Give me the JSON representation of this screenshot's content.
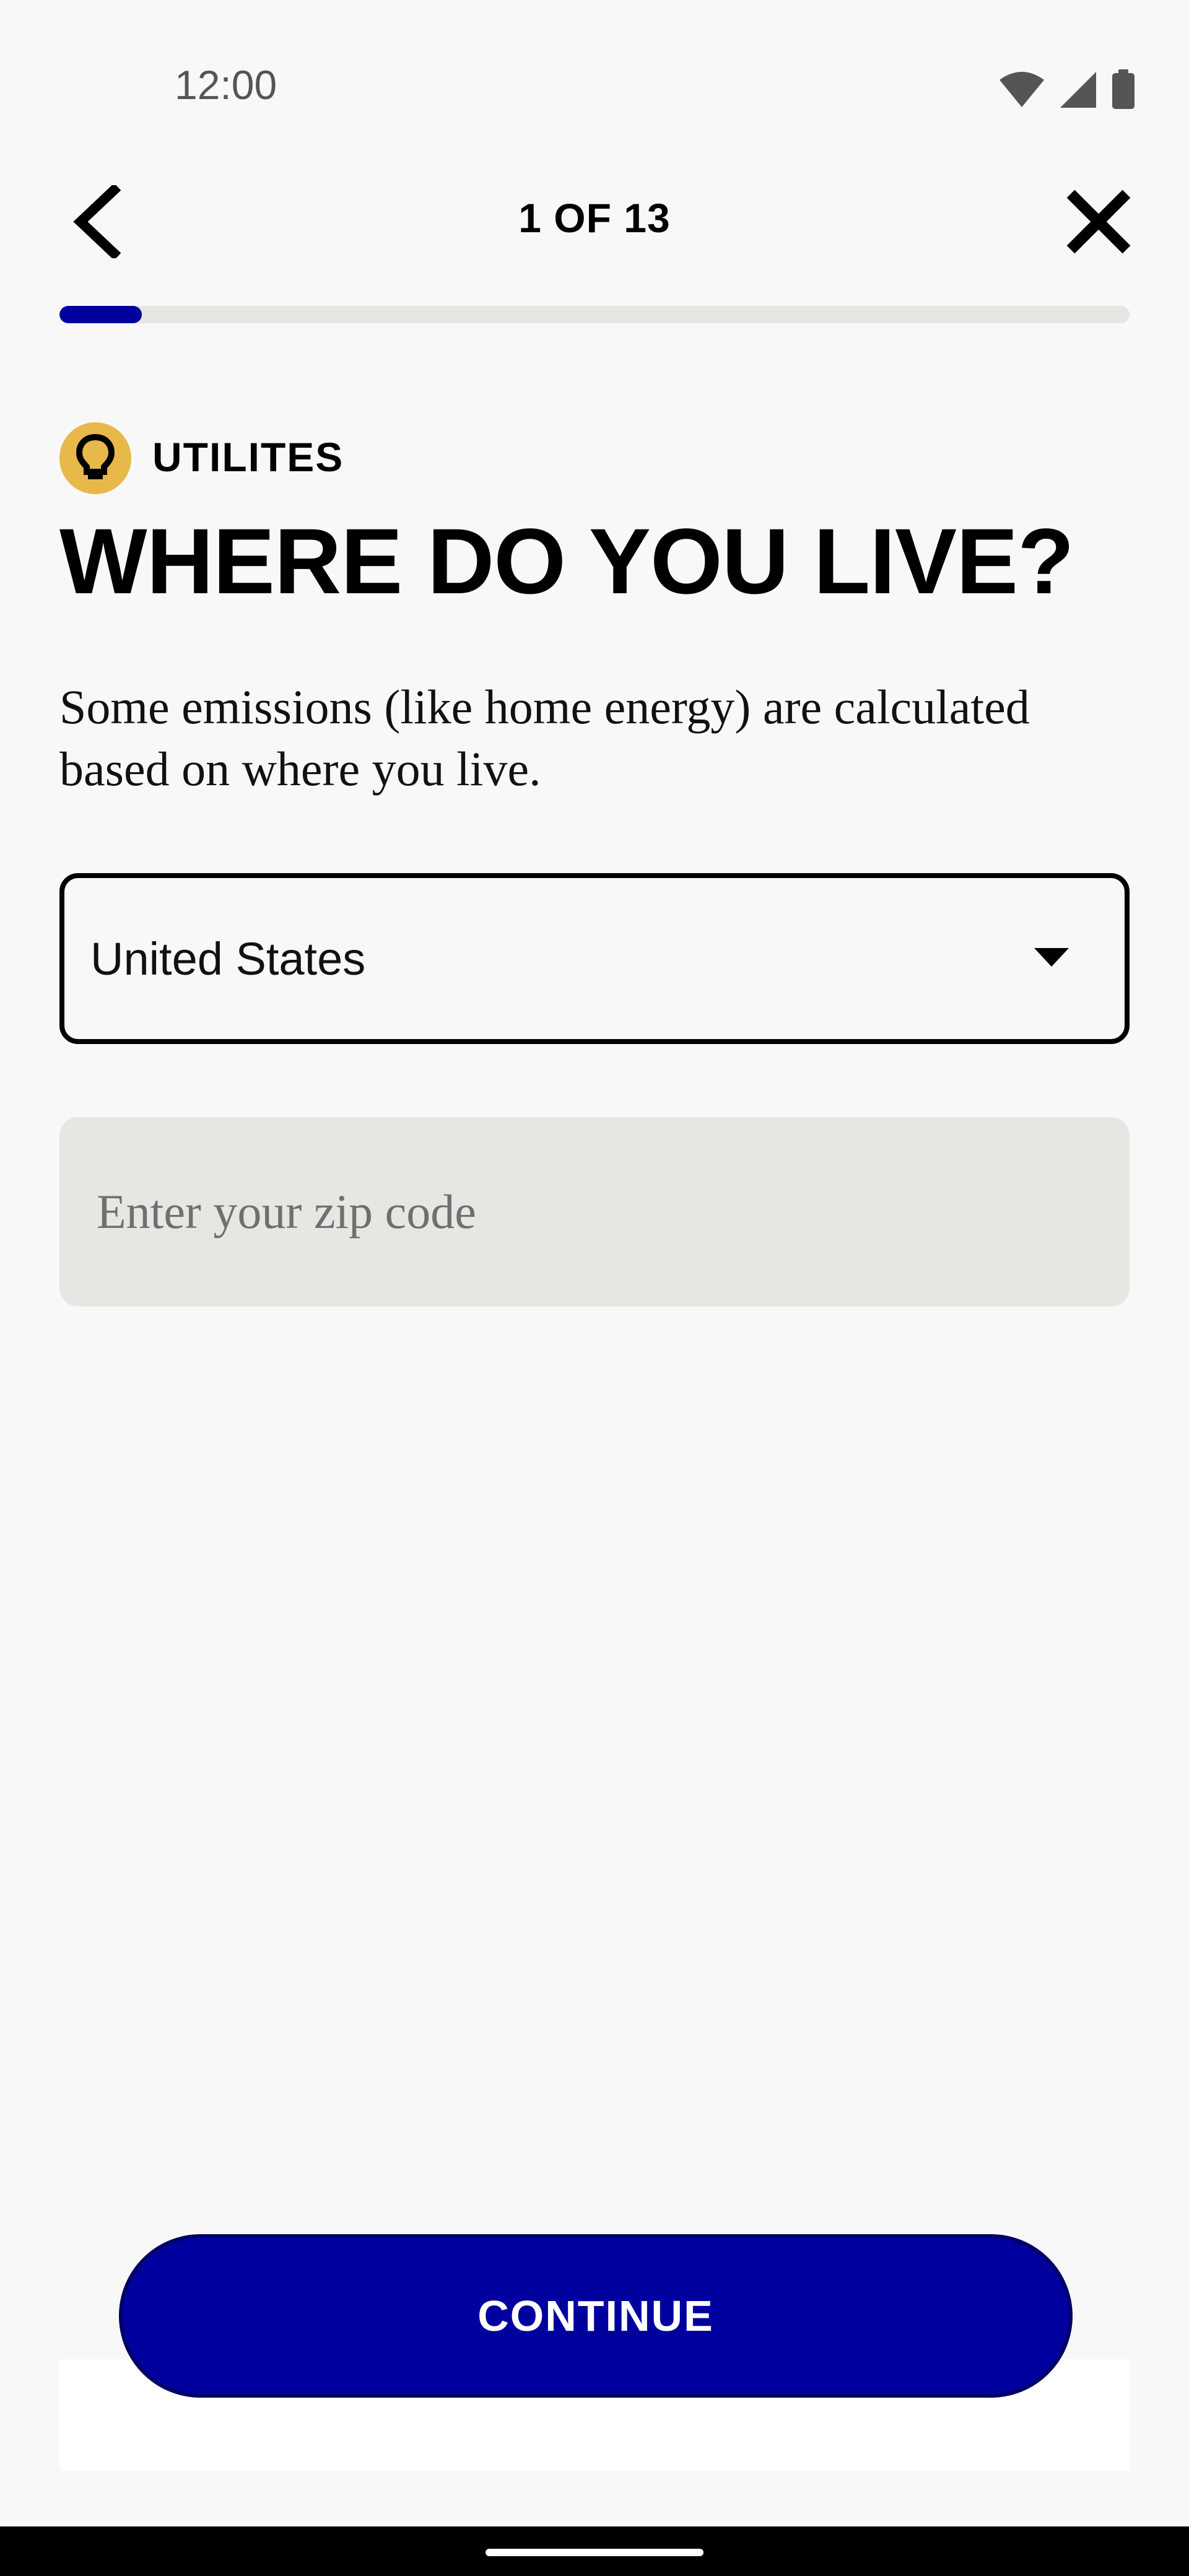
{
  "status_bar": {
    "time": "12:00",
    "icons": [
      "wifi-icon",
      "cellular-signal-icon",
      "battery-icon"
    ]
  },
  "header": {
    "back_icon": "chevron-left-icon",
    "step_label": "1 OF 13",
    "close_icon": "close-icon"
  },
  "progress": {
    "current": 1,
    "total": 13,
    "fraction": 0.077,
    "fill_color": "#00009e",
    "track_color": "#e6e5e2"
  },
  "category": {
    "icon": "lightbulb-icon",
    "icon_bg_color": "#e7b84a",
    "label": "UTILITES"
  },
  "title": "WHERE DO YOU LIVE?",
  "description": "Some emissions (like home energy) are calculated based on where you live.",
  "country_select": {
    "value": "United States",
    "arrow_icon": "dropdown-arrow-icon"
  },
  "zip_input": {
    "value": "",
    "placeholder": "Enter your zip code"
  },
  "continue_button": {
    "label": "CONTINUE",
    "color": "#00009e"
  }
}
